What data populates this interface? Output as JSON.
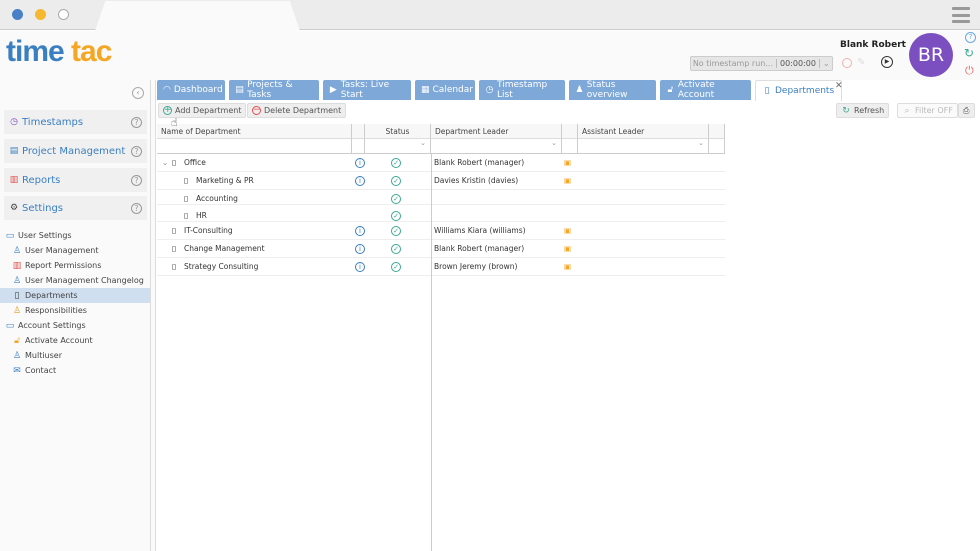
{
  "logo": {
    "part1": "time",
    "part2": "tac"
  },
  "user": {
    "name": "Blank Robert",
    "initials": "BR",
    "avatar_color": "#7b4fc0"
  },
  "timestamp": {
    "placeholder": "No timestamp run...",
    "time": "00:00:00"
  },
  "tabs": [
    {
      "label": "Dashboard",
      "icon": "dashboard-icon"
    },
    {
      "label": "Projects & Tasks",
      "icon": "folder-icon"
    },
    {
      "label": "Tasks: Live Start",
      "icon": "play-icon"
    },
    {
      "label": "Calendar",
      "icon": "calendar-icon"
    },
    {
      "label": "Timestamp List",
      "icon": "clock-icon"
    },
    {
      "label": "Status overview",
      "icon": "user-icon"
    },
    {
      "label": "Activate Account",
      "icon": "lock-icon"
    },
    {
      "label": "Departments",
      "icon": "departments-icon",
      "active": true
    }
  ],
  "toolbar": {
    "add": "Add Department",
    "delete": "Delete Department",
    "refresh": "Refresh",
    "filter": "Filter OFF"
  },
  "sidebar": {
    "sections": [
      {
        "label": "Timestamps"
      },
      {
        "label": "Project Management"
      },
      {
        "label": "Reports"
      },
      {
        "label": "Settings"
      }
    ],
    "tree": [
      {
        "label": "User Settings",
        "level": 0
      },
      {
        "label": "User Management",
        "level": 1
      },
      {
        "label": "Report Permissions",
        "level": 1
      },
      {
        "label": "User Management Changelog",
        "level": 1
      },
      {
        "label": "Departments",
        "level": 1,
        "selected": true
      },
      {
        "label": "Responsibilities",
        "level": 1
      },
      {
        "label": "Account Settings",
        "level": 0
      },
      {
        "label": "Activate Account",
        "level": 1
      },
      {
        "label": "Multiuser",
        "level": 1
      },
      {
        "label": "Contact",
        "level": 1
      }
    ]
  },
  "grid": {
    "columns": [
      "Name of Department",
      "Status",
      "Department Leader",
      "Assistant Leader"
    ],
    "rows": [
      {
        "name": "Office",
        "level": 0,
        "expanded": true,
        "info": true,
        "leader": "Blank Robert (manager)"
      },
      {
        "name": "Marketing & PR",
        "level": 1,
        "info": true,
        "leader": "Davies Kristin (davies)"
      },
      {
        "name": "Accounting",
        "level": 1,
        "info": false,
        "leader": ""
      },
      {
        "name": "HR",
        "level": 1,
        "info": false,
        "leader": ""
      },
      {
        "name": "IT-Consulting",
        "level": 0,
        "info": true,
        "leader": "Williams Kiara (williams)"
      },
      {
        "name": "Change Management",
        "level": 0,
        "info": true,
        "leader": "Blank Robert (manager)"
      },
      {
        "name": "Strategy Consulting",
        "level": 0,
        "info": true,
        "leader": "Brown Jeremy (brown)"
      }
    ]
  }
}
